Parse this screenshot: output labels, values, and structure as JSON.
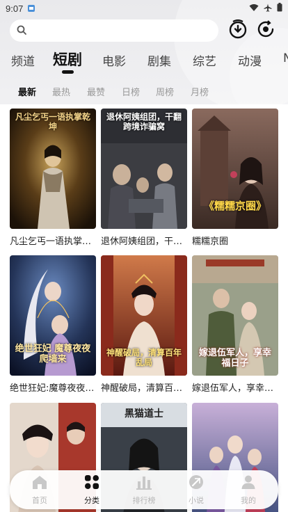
{
  "status_bar": {
    "time": "9:07"
  },
  "search": {
    "placeholder": ""
  },
  "channels": [
    {
      "label": "频道",
      "active": false
    },
    {
      "label": "短剧",
      "active": true
    },
    {
      "label": "电影",
      "active": false
    },
    {
      "label": "剧集",
      "active": false
    },
    {
      "label": "综艺",
      "active": false
    },
    {
      "label": "动漫",
      "active": false
    },
    {
      "label": "N",
      "active": false
    }
  ],
  "sorts": [
    {
      "label": "最新",
      "active": true
    },
    {
      "label": "最热",
      "active": false
    },
    {
      "label": "最赞",
      "active": false
    },
    {
      "label": "日榜",
      "active": false
    },
    {
      "label": "周榜",
      "active": false
    },
    {
      "label": "月榜",
      "active": false
    }
  ],
  "cards": [
    {
      "title": "凡尘乞丐一语执掌乾坤",
      "poster_text": "凡尘乞丐一语执掌乾坤",
      "theme": "#3a2a12"
    },
    {
      "title": "退休阿姨组团，干翻跨境诈骗窝",
      "poster_text": "退休阿姨组团，干翻跨境诈骗窝",
      "theme": "#2b2b2e"
    },
    {
      "title": "糯糯京圈",
      "poster_text": "《糯糯京圈》",
      "theme": "#6a4a3a"
    },
    {
      "title": "绝世狂妃:魔尊夜夜爬墙来",
      "poster_text": "绝世狂妃 魔尊夜夜爬墙来",
      "theme": "#1e2a4a"
    },
    {
      "title": "神醒破局，清算百年乱局",
      "poster_text": "神醒破局，清算百年乱局",
      "theme": "#7a2418"
    },
    {
      "title": "嫁退伍军人，享幸福日子",
      "poster_text": "嫁退伍军人，享幸福日子",
      "theme": "#5a6a4a"
    },
    {
      "title": "",
      "poster_text": "",
      "theme": "#8a5040"
    },
    {
      "title": "",
      "poster_text": "黑猫道士",
      "theme": "#3a3f48"
    },
    {
      "title": "",
      "poster_text": "",
      "theme": "#4a5a8a"
    }
  ],
  "bottom_nav": [
    {
      "label": "首页",
      "icon": "home-icon",
      "active": false
    },
    {
      "label": "分类",
      "icon": "category-icon",
      "active": true
    },
    {
      "label": "排行榜",
      "icon": "chart-icon",
      "active": false
    },
    {
      "label": "小说",
      "icon": "novel-icon",
      "active": false
    },
    {
      "label": "我的",
      "icon": "user-icon",
      "active": false
    }
  ]
}
